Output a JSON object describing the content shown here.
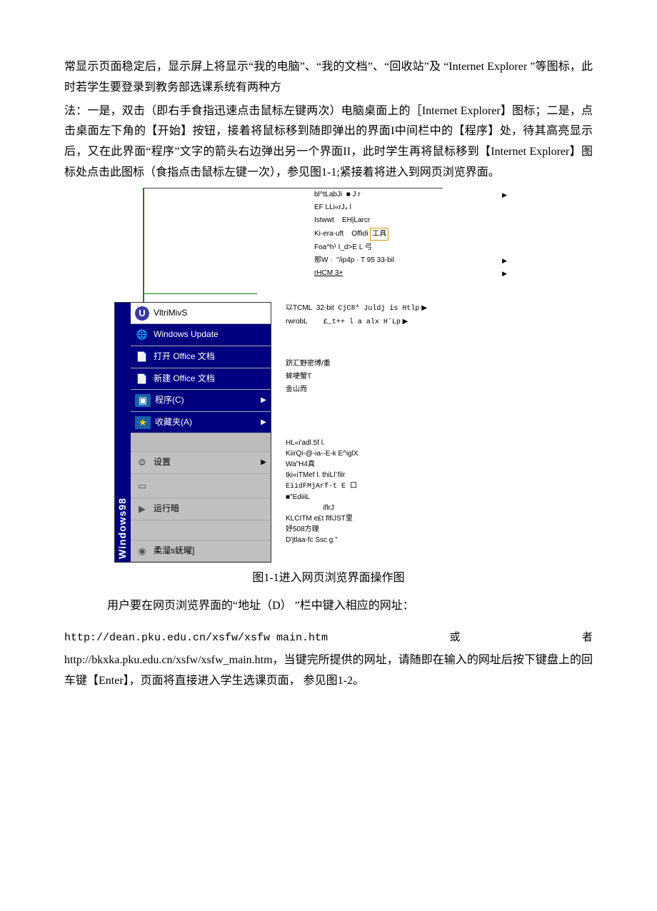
{
  "para1": "常显示页面稳定后，显示屏上将显示“我的电脑”、“我的文档”、“回收站”及 “Internet Explorer ”等图标，此时若学生要登录到教务部选课系统有两种方",
  "para2": "法：一是，双击（即右手食指迅速点击鼠标左键两次）电脑桌面上的［Internet Explorer】图标；二是，点击桌面左下角的【开始】按钮，接着将鼠标移到随即弹出的界面I中间栏中的【程序】处，待其高亮显示后，又在此界面“程序”文字的箭头右边弹出另一个界面II，此时学生再将鼠标移到【Internet Explorer】图标处点击此图标（食指点击鼠标左键一次），参见图1-1;紧接着将进入到网页浏览界面。",
  "topmenu": [
    {
      "l": "bl^tLabJi",
      "r": "■ J r",
      "arrow": true
    },
    {
      "l": "EF LLi«rJ₄ l",
      "r": "",
      "arrow": false
    },
    {
      "l": "Istwwt",
      "r": "EH|Larcr",
      "arrow": false
    },
    {
      "l": "Ki-era-uft",
      "r": "Offidi",
      "hl": "工具",
      "arrow": false
    },
    {
      "l": "Foa^h¹ I_d>E L 弓",
      "r": "",
      "arrow": false
    },
    {
      "l": "那W ·",
      "r": "\"/ip4p · T 95 33-bil",
      "arrow": true
    },
    {
      "l": "rHCM 3+",
      "r": "",
      "arrow": true
    }
  ],
  "midmenu": {
    "r1l": "以TCML",
    "r1m": "32-bit",
    "r1r": "CjC®* Juldj is Htlp",
    "r1arrow": true,
    "r2l": "rwrobL",
    "r2r": "£_t++ l a alx HˉLp",
    "r2arrow": true
  },
  "start": {
    "sidebar": "Windows98",
    "items": [
      {
        "icon": "UE",
        "label": "VltriMivS",
        "style": "white"
      },
      {
        "icon": "globe",
        "label": "Windows Update",
        "style": "blue"
      },
      {
        "icon": "doc",
        "label": "打开 Office 文档",
        "style": "blue"
      },
      {
        "icon": "doc",
        "label": "新建 Office 文档",
        "style": "blue"
      },
      {
        "icon": "folder",
        "label": "程序(C)",
        "style": "blue",
        "arrow": true
      },
      {
        "icon": "star",
        "label": "收藏夹(A)",
        "style": "blue",
        "arrow": true
      },
      {
        "icon": "gray",
        "label": "设置",
        "style": "gray",
        "arrow": true
      },
      {
        "icon": "gray",
        "label": "",
        "style": "gray"
      },
      {
        "icon": "gray",
        "label": "运行暗",
        "style": "gray"
      },
      {
        "icon": "gray",
        "label": "柔溜s妩曜]",
        "style": "gray"
      }
    ]
  },
  "midright": [
    "跻汇野密博/重",
    "蛑哽蟹T",
    "金山而"
  ],
  "botright": [
    "HL«i'adl.5f l.",
    "KiirQi-@-ia--E-k E^iglX",
    "Wa\"H4真",
    "tki«iTMef l. thiLlˉfilr",
    "EiidFMjArf-t E 口",
    "■\"EdiiiL",
    "iflrJ",
    "KLCITM e£t flfiJST里",
    "妤508方理",
    "D'jtlaa-fc Ssc g \""
  ],
  "caption": "图1-1进入网页浏览界面操作图",
  "instruction": "用户要在网页浏览界面的“地址（D） ”栏中键入相应的网址：",
  "url_line1_left": "http://dean.pku.edu.cn/xsfw/xsfw main.htm",
  "url_line1_mid": "或",
  "url_line1_right": "者",
  "para3": "http://bkxka.pku.edu.cn/xsfw/xsfw_main.htm，当键完所提供的网址，请随即在输入的网址后按下键盘上的回车键【Enter】，页面将直接进入学生选课页面， 参见图1-2。"
}
